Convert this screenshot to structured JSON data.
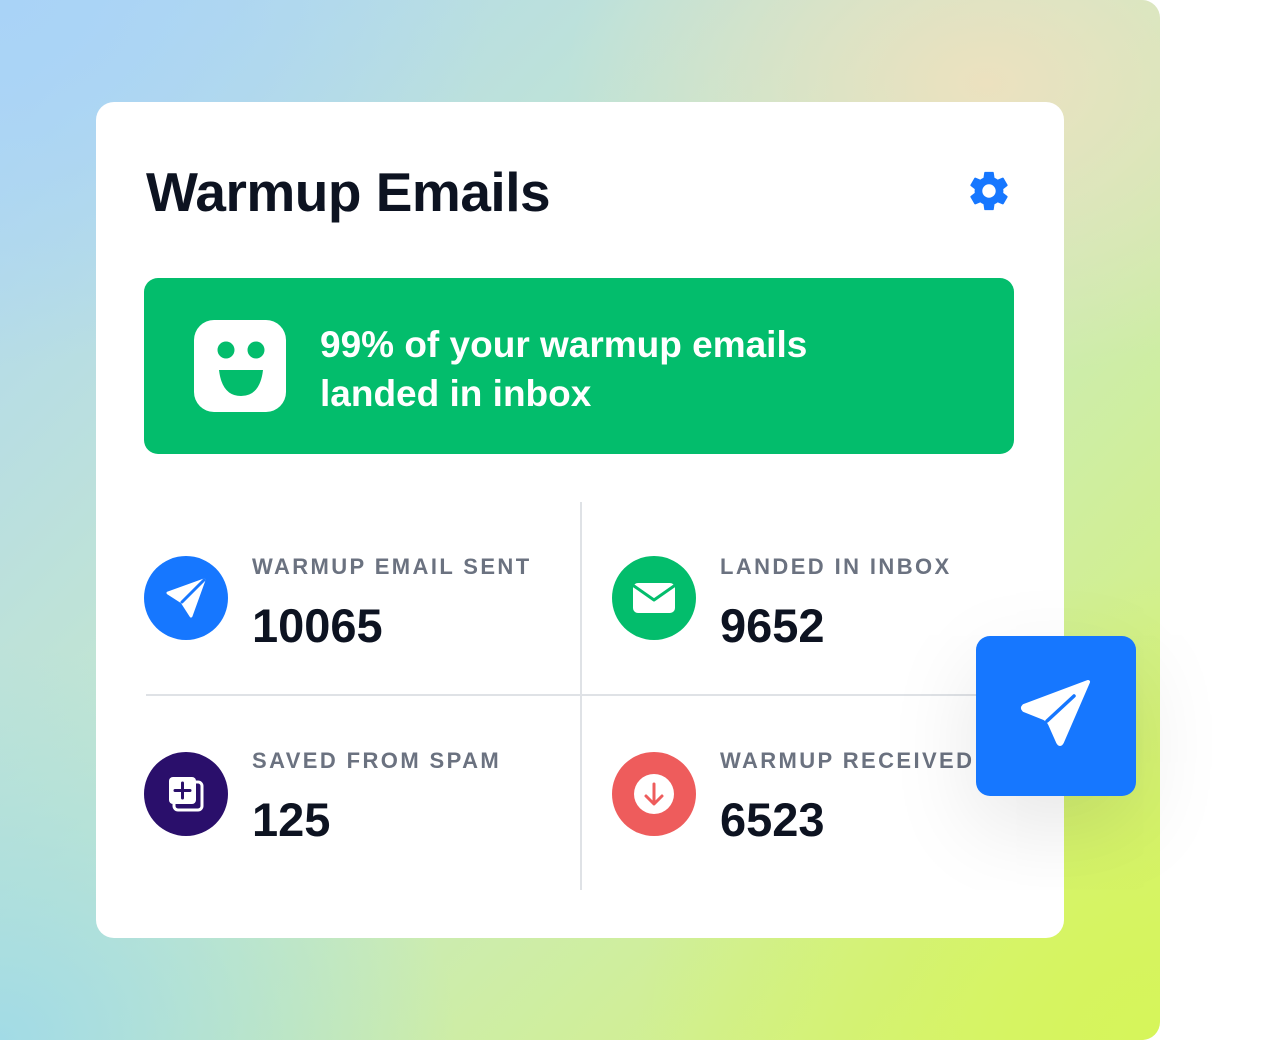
{
  "card": {
    "title": "Warmup Emails",
    "settings_icon": "gear-icon"
  },
  "banner": {
    "line1": "99% of your warmup emails",
    "line2": "landed in inbox",
    "icon": "smiley-face-icon",
    "color": "#03bd6c"
  },
  "stats": [
    {
      "label": "WARMUP EMAIL SENT",
      "value": "10065",
      "icon": "paper-plane-icon",
      "color": "#1677ff"
    },
    {
      "label": "LANDED IN INBOX",
      "value": "9652",
      "icon": "envelope-icon",
      "color": "#03bd6c"
    },
    {
      "label": "SAVED FROM SPAM",
      "value": "125",
      "icon": "add-copy-icon",
      "color": "#2a0f6b"
    },
    {
      "label": "WARMUP RECEIVED",
      "value": "6523",
      "icon": "download-arrow-icon",
      "color": "#ee5c5c"
    }
  ],
  "floating_button": {
    "icon": "navigation-arrow-icon",
    "color": "#1677ff"
  }
}
